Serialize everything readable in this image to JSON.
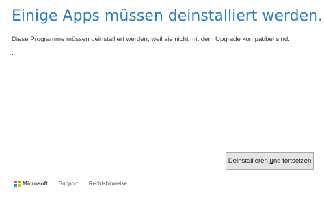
{
  "header": {
    "title": "Einige Apps müssen deinstalliert werden.",
    "subtitle": "Diese Programme müssen deinstalliert werden, weil sie nicht mit dem Upgrade kompatibel sind."
  },
  "app_list": {
    "items": [
      ""
    ]
  },
  "actions": {
    "primary_before": "Deinstallieren ",
    "primary_accel": "u",
    "primary_after": "nd fortsetzen"
  },
  "footer": {
    "brand": "Microsoft",
    "links": [
      "Support",
      "Rechtshinweise"
    ]
  },
  "colors": {
    "title": "#2b7cbf",
    "button_bg": "#e5e5e5",
    "button_border": "#a8a8a8",
    "logo_red": "#f25022",
    "logo_green": "#7fba00",
    "logo_blue": "#00a4ef",
    "logo_yellow": "#ffb900"
  },
  "icons": {
    "brand_logo": "microsoft-logo-icon"
  }
}
